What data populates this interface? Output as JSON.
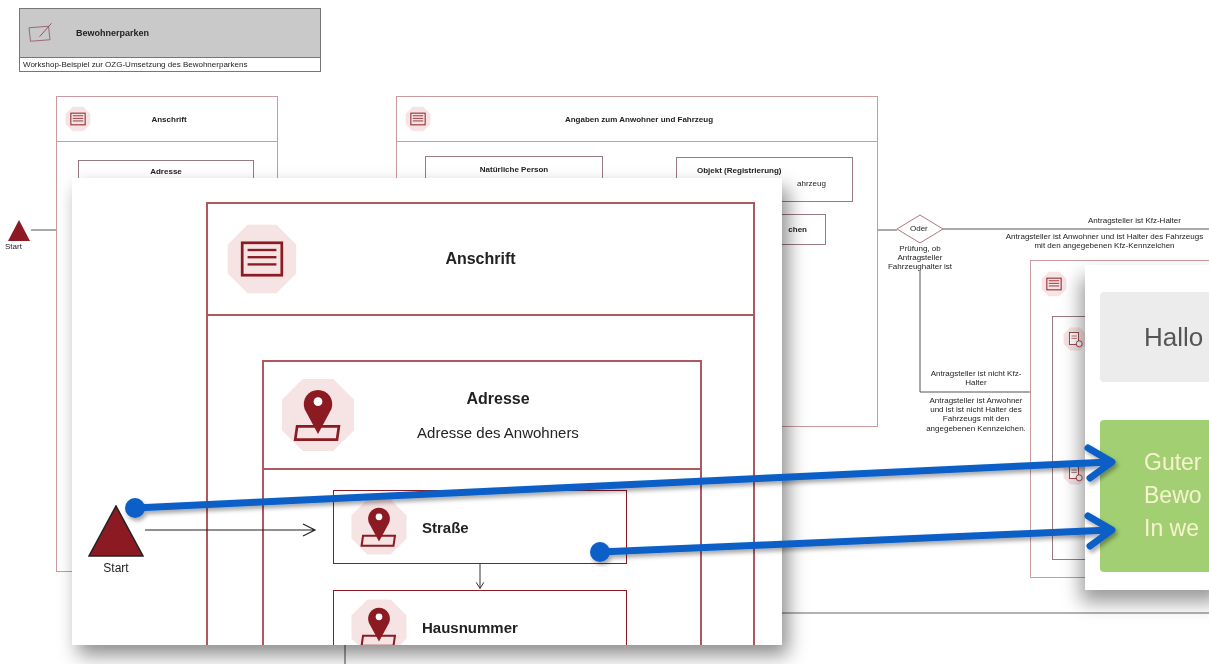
{
  "title_card": {
    "title": "Bewohnerparken",
    "description": "Workshop-Beispiel zur OZG-Umsetzung des Bewohnerparkens"
  },
  "background_diagram": {
    "start_label": "Start",
    "anschrift": {
      "title": "Anschrift",
      "child": "Adresse"
    },
    "angaben": {
      "title": "Angaben zum Anwohner und Fahrzeug",
      "children": [
        {
          "title": "Natürliche Person"
        },
        {
          "title": "Objekt (Registrierung)",
          "subtitle": "ahrzeug"
        }
      ],
      "kennzeichen": "chen"
    },
    "gateway": {
      "label": "Oder",
      "caption": "Prüfung, ob Antragsteller Fahrzeughalter ist"
    },
    "branches": [
      {
        "condition": "Antragsteller ist Kfz-Halter",
        "description": "Antragsteller ist Anwohner und ist Halter des Fahrzeugs mit den angegebenen Kfz-Kennzeichen"
      },
      {
        "condition": "Antragsteller ist nicht Kfz-Halter",
        "description": "Antragsteller ist Anwohner und ist ist nicht Halter des Fahrzeugs mit den angegebenen Kennzeichen."
      }
    ]
  },
  "zoom_detail": {
    "start_label": "Start",
    "group_title": "Anschrift",
    "address": {
      "title": "Adresse",
      "subtitle": "Adresse des Anwohners"
    },
    "steps": [
      "Straße",
      "Hausnummer"
    ]
  },
  "form_preview": {
    "greeting": "Hallo",
    "message_lines": [
      "Guter",
      "Bewo",
      "In we"
    ]
  }
}
